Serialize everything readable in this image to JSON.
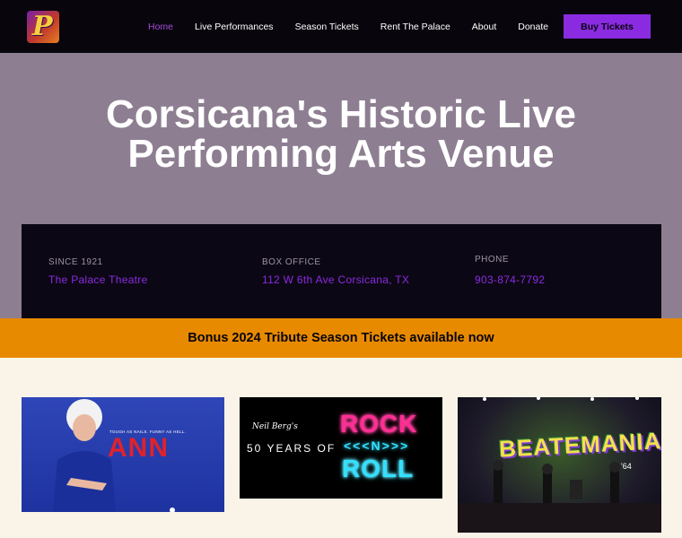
{
  "header": {
    "logo_letter": "P",
    "nav": [
      {
        "label": "Home",
        "active": true
      },
      {
        "label": "Live Performances",
        "active": false
      },
      {
        "label": "Season Tickets",
        "active": false
      },
      {
        "label": "Rent The Palace",
        "active": false
      },
      {
        "label": "About",
        "active": false
      },
      {
        "label": "Donate",
        "active": false
      }
    ],
    "buy_tickets_label": "Buy Tickets"
  },
  "hero": {
    "title_line1": "Corsicana's Historic Live",
    "title_line2": "Performing Arts Venue"
  },
  "info": {
    "since": {
      "label": "SINCE 1921",
      "value": "The Palace Theatre"
    },
    "box_office": {
      "label": "BOX OFFICE",
      "value": "112 W 6th Ave Corsicana, TX"
    },
    "phone": {
      "label": "PHONE",
      "value": "903-874-7792"
    }
  },
  "banner": {
    "text": "Bonus 2024 Tribute Season Tickets available now"
  },
  "cards": {
    "ann": {
      "tagline": "TOUGH AS NAILS. FUNNY AS HELL.",
      "title": "ANN"
    },
    "rock": {
      "signature": "Neil Berg's",
      "subtitle": "50 YEARS OF",
      "line1": "ROCK",
      "line2": "<<<N>>>",
      "line3": "ROLL"
    },
    "beat": {
      "title": "BEATEMANIA",
      "suffix": "'64"
    }
  },
  "colors": {
    "accent": "#8a2be2",
    "banner": "#e88a00",
    "hero_bg": "#8d7e91",
    "header_bg": "#08050c"
  }
}
